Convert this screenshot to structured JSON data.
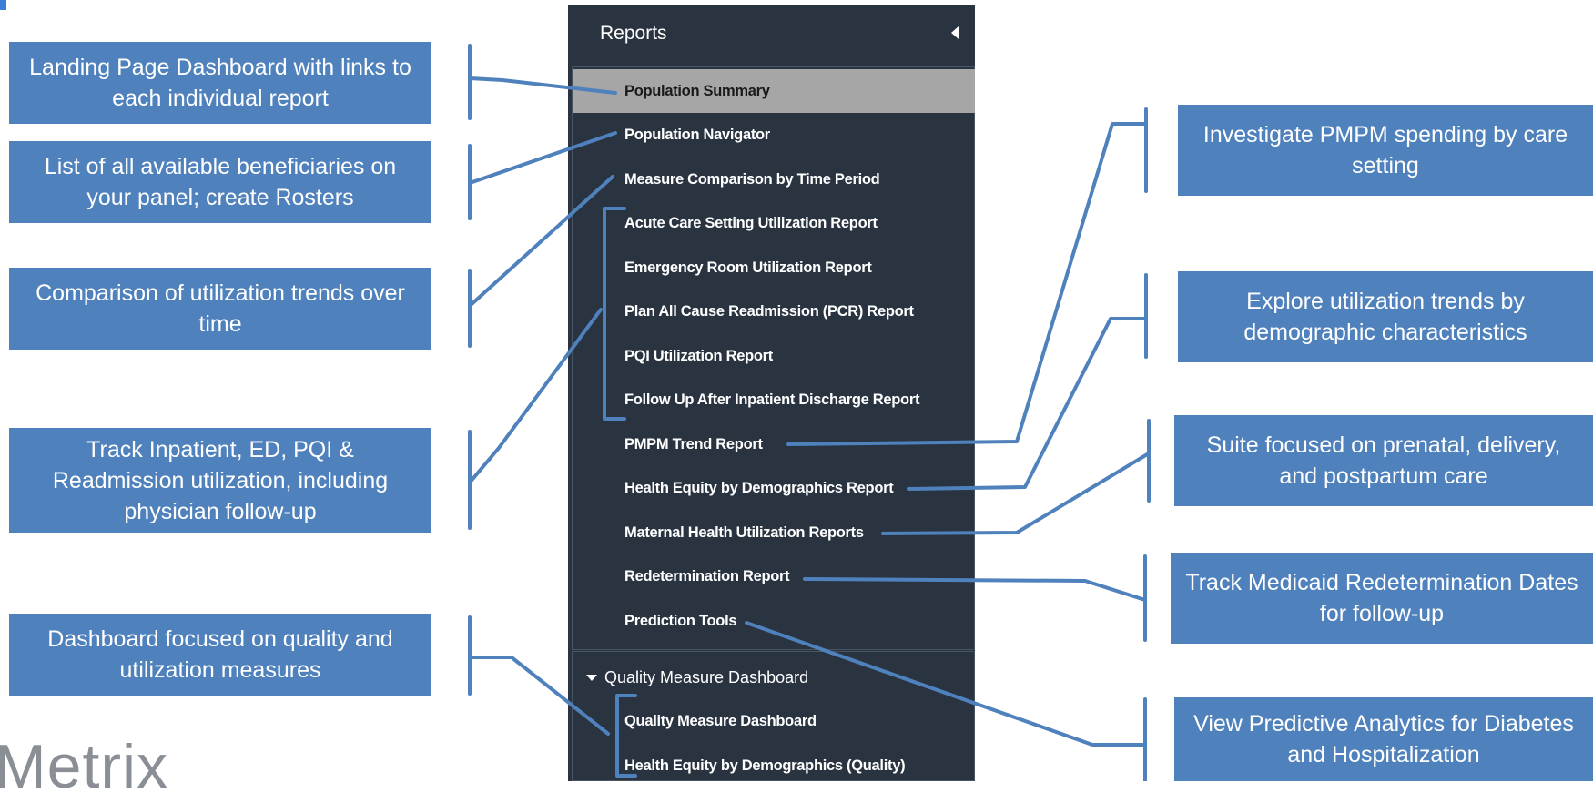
{
  "panel": {
    "title": "Reports",
    "items": [
      "Population Summary",
      "Population Navigator",
      "Measure Comparison by Time Period",
      "Acute Care Setting Utilization Report",
      "Emergency Room Utilization Report",
      "Plan All Cause Readmission (PCR) Report",
      "PQI Utilization Report",
      "Follow Up After Inpatient Discharge Report",
      "PMPM Trend Report",
      "Health Equity by Demographics Report",
      "Maternal Health Utilization Reports",
      "Redetermination Report",
      "Prediction Tools"
    ],
    "section": {
      "title": "Quality Measure Dashboard",
      "items": [
        "Quality Measure Dashboard",
        "Health Equity by Demographics (Quality)"
      ]
    }
  },
  "callouts": {
    "left": [
      "Landing Page Dashboard with links to each individual report",
      "List of all available beneficiaries on your panel; create Rosters",
      "Comparison of utilization trends over time",
      "Track Inpatient, ED, PQI & Readmission utilization, including physician follow-up",
      "Dashboard focused on quality and utilization measures"
    ],
    "right": [
      "Investigate PMPM spending by care setting",
      "Explore utilization trends by demographic characteristics",
      "Suite focused on prenatal, delivery, and postpartum care",
      "Track Medicaid Redetermination Dates for follow-up",
      "View Predictive Analytics for Diabetes and Hospitalization"
    ]
  },
  "logo": "Metrix",
  "colors": {
    "callout_fill": "#4f81bd",
    "connector": "#4f81bd",
    "panel_bg": "#2a3441",
    "active_item_bg": "#a6a6a6"
  }
}
